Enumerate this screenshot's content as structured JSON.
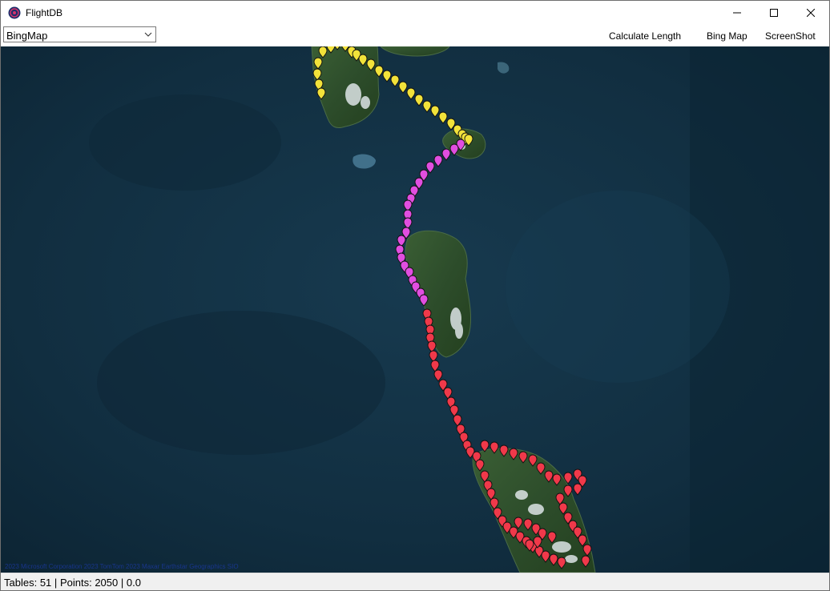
{
  "window": {
    "title": "FlightDB"
  },
  "toolbar": {
    "map_select": {
      "selected": "BingMap"
    },
    "buttons": {
      "calculate_length": "Calculate Length",
      "bing_map": "Bing Map",
      "screenshot": "ScreenShot"
    }
  },
  "map": {
    "copyright": "2023 Microsoft Corporation  2023 TomTom  2023 Maxar  Earthstar Geographics SIO",
    "track_colors": {
      "segment_1": "#f2e23a",
      "segment_2": "#e14ee0",
      "segment_3": "#f0394a"
    }
  },
  "status": {
    "tables_label": "Tables:",
    "tables_value": "51",
    "points_label": "Points:",
    "points_value": "2050",
    "extra_value": "0.0"
  }
}
